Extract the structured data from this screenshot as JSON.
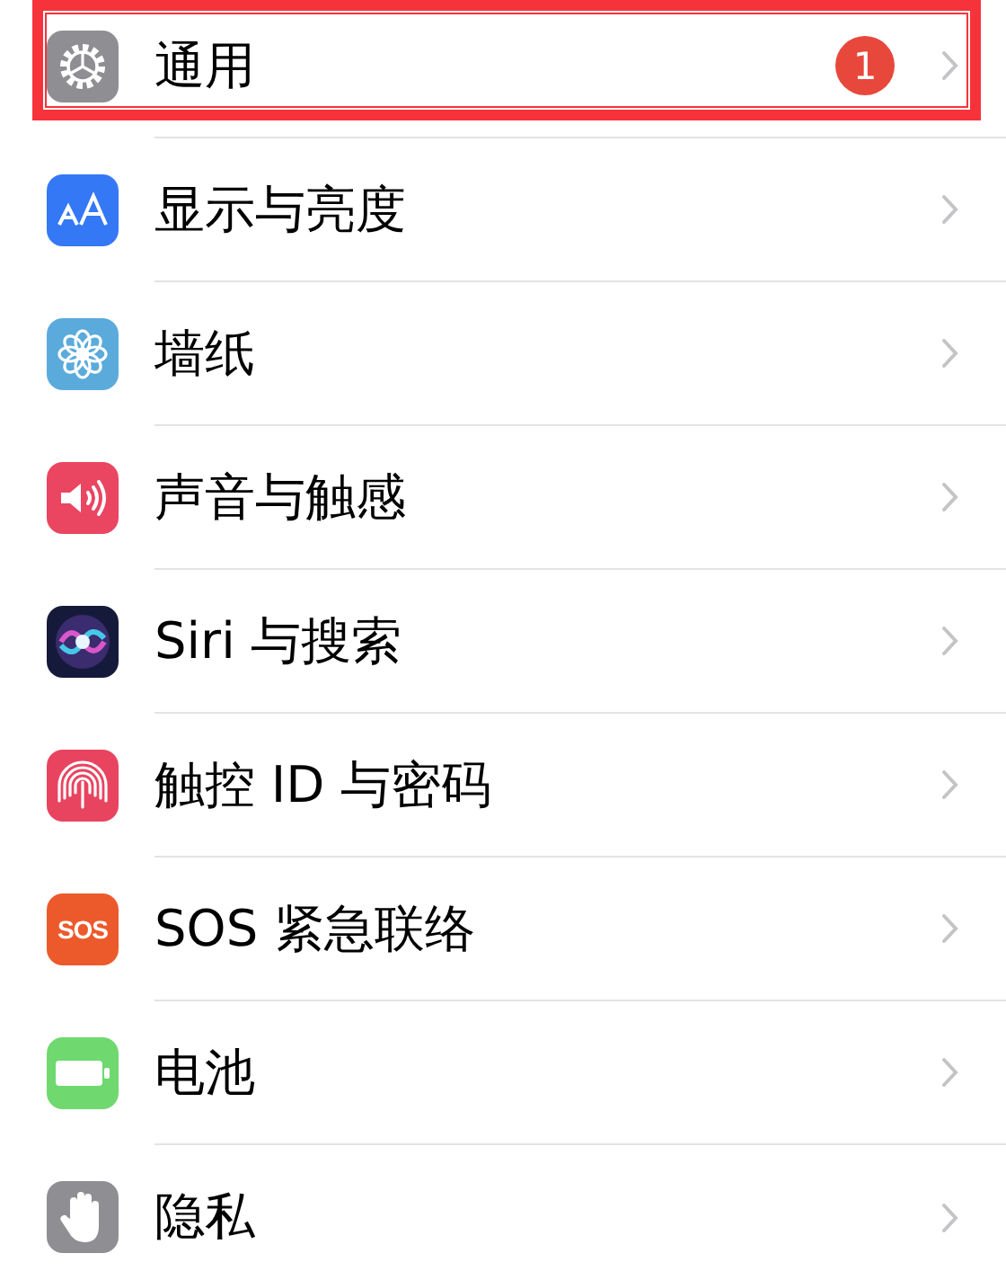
{
  "settings_rows": [
    {
      "kind": "gear",
      "label": "通用",
      "badge": "1",
      "highlighted": true
    },
    {
      "kind": "display",
      "label": "显示与亮度",
      "highlighted": false
    },
    {
      "kind": "flower",
      "label": "墙纸",
      "highlighted": false
    },
    {
      "kind": "sound",
      "label": "声音与触感",
      "highlighted": false
    },
    {
      "kind": "siri",
      "label": "Siri 与搜索",
      "highlighted": false
    },
    {
      "kind": "fingerprint",
      "label": "触控 ID 与密码",
      "highlighted": false
    },
    {
      "kind": "sos",
      "label": "SOS 紧急联络",
      "icon_text": "SOS",
      "highlighted": false
    },
    {
      "kind": "battery",
      "label": "电池",
      "highlighted": false
    },
    {
      "kind": "hand",
      "label": "隐私",
      "highlighted": false
    }
  ]
}
